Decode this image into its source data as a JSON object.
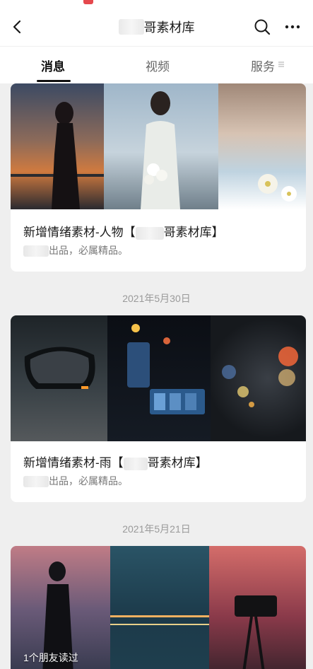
{
  "status_bar": {
    "left_text": "",
    "right_text": ""
  },
  "header": {
    "title_visible": "哥素材库",
    "icons": {
      "back": "back-arrow-icon",
      "search": "search-icon",
      "more": "more-dots-icon"
    }
  },
  "tabs": [
    {
      "label": "消息",
      "active": true
    },
    {
      "label": "视频",
      "active": false
    },
    {
      "label": "服务",
      "active": false
    }
  ],
  "articles": [
    {
      "title_prefix": "新增情绪素材-人物【",
      "title_suffix": "哥素材库】",
      "subtitle": "出品，必属精品。",
      "image_names": [
        "sunset-silhouette-photo",
        "woman-flowers-photo",
        "daisy-closeup-photo"
      ]
    },
    {
      "date": "2021年5月30日",
      "title_prefix": "新增情绪素材-雨【",
      "title_suffix": "哥素材库】",
      "subtitle": "出品，必属精品。",
      "image_names": [
        "car-mirror-rain-photo",
        "car-dashboard-photo",
        "rainy-window-bokeh-photo"
      ]
    },
    {
      "date": "2021年5月21日",
      "friends_read": "1个朋友读过",
      "image_names": [
        "dusk-photographer-photo",
        "city-night-bridge-photo",
        "tripod-camera-photo"
      ]
    }
  ],
  "colors": {
    "background": "#efefef",
    "card": "#ffffff",
    "accent": "#111111",
    "muted": "#9a9a9a"
  }
}
